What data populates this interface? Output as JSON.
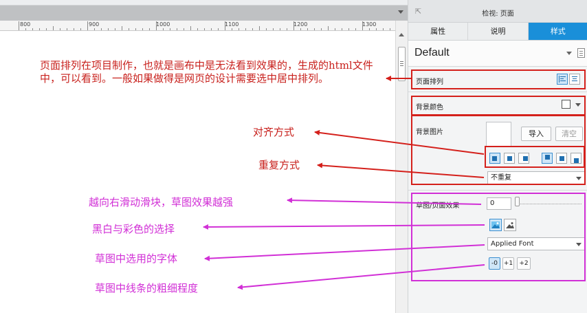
{
  "canvas": {
    "ruler_labels": [
      "800",
      "900",
      "1000",
      "1100",
      "1200",
      "1300"
    ],
    "annotations": {
      "page_arrange": "页面排列在项目制作，也就是画布中是无法看到效果的，生成的html文件中，可以看到。一般如果做得是网页的设计需要选中居中排列。",
      "align_mode": "对齐方式",
      "repeat_mode": "重复方式",
      "slider_hint": "越向右滑动滑块，草图效果越强",
      "bw_color": "黑白与彩色的选择",
      "sketch_font": "草图中选用的字体",
      "line_thickness": "草图中线条的粗细程度"
    }
  },
  "inspector": {
    "title": "检视: 页面",
    "tabs": [
      "属性",
      "说明",
      "样式"
    ],
    "active_tab": "样式",
    "style_name": "Default",
    "page_arrange_label": "页面排列",
    "bg_color_label": "背景颜色",
    "bg_image_label": "背景图片",
    "import_button": "导入",
    "clear_button": "清空",
    "repeat_value": "不重复",
    "sketch_label": "草图/页面效果",
    "sketch_value": "0",
    "font_value": "Applied Font",
    "line_buttons": [
      "-0",
      "+1",
      "+2"
    ]
  },
  "colors": {
    "accent_tab": "#1a8fd9",
    "annotation_red": "#c8211d",
    "annotation_pink": "#d12fd6"
  }
}
